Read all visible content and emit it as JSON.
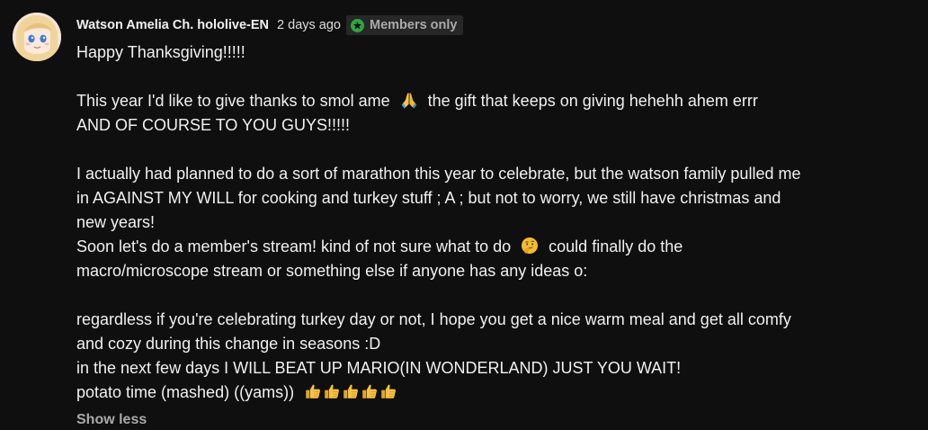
{
  "comment": {
    "author": "Watson Amelia Ch. hololive-EN",
    "timestamp": "2 days ago",
    "badge_label": "Members only",
    "badge_icon": "star-icon",
    "badge_icon_color": "#2ba640",
    "lines": [
      "Happy Thanksgiving!!!!!",
      "",
      "This year I'd like to give thanks to smol ame",
      "the gift that keeps on giving hehehh ahem errr",
      "AND OF COURSE TO YOU GUYS!!!!!",
      "",
      "I actually had planned to do a sort of marathon this year to celebrate, but the watson family pulled me",
      "in AGAINST MY WILL for cooking and turkey stuff ; A ; but not to worry, we still have christmas and",
      "new years!",
      "Soon let's do a member's stream! kind of not sure what to do",
      "could finally do the",
      "macro/microscope stream or something else if anyone has any ideas o:",
      "",
      "regardless if you're celebrating turkey day or not, I hope you get a nice warm meal and get all comfy",
      "and cozy during this change in seasons :D",
      "in the next few days I WILL BEAT UP MARIO(IN WONDERLAND) JUST YOU WAIT!",
      "potato time (mashed) ((yams))"
    ],
    "emojis": {
      "praying_hands": "folded-hands-emoji",
      "thinking": "thinking-face-emoji",
      "thumbs_up": "thumbs-up-emoji",
      "thumbs_up_count": 5
    },
    "show_less_label": "Show less"
  },
  "colors": {
    "background": "#0f0f0f",
    "text_primary": "#f1f1f1",
    "text_secondary": "#aaaaaa",
    "badge_background": "#272727"
  }
}
